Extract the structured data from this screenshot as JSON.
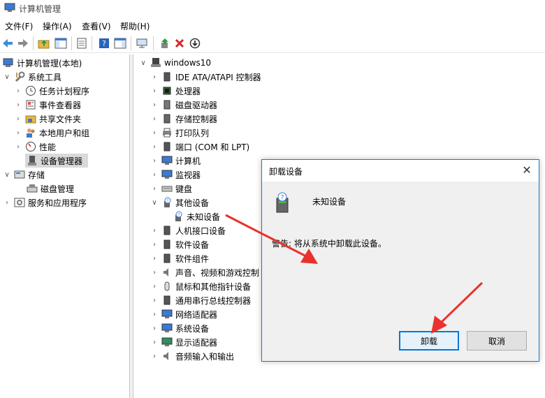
{
  "window": {
    "title": "计算机管理"
  },
  "menu": [
    "文件(F)",
    "操作(A)",
    "查看(V)",
    "帮助(H)"
  ],
  "toolbar": {
    "buttons": [
      "back-icon",
      "forward-icon",
      "up-folder-icon",
      "show-hide-tree-icon",
      "properties-icon",
      "help-icon",
      "action-pane-icon",
      "monitor-icon",
      "update-driver-icon",
      "uninstall-icon",
      "disable-icon"
    ]
  },
  "left_tree": [
    {
      "label": "计算机管理(本地)",
      "icon": "computer-management-icon"
    },
    {
      "label": "系统工具",
      "icon": "tools-icon"
    },
    {
      "label": "任务计划程序",
      "icon": "clock-icon"
    },
    {
      "label": "事件查看器",
      "icon": "event-viewer-icon"
    },
    {
      "label": "共享文件夹",
      "icon": "shared-folder-icon"
    },
    {
      "label": "本地用户和组",
      "icon": "users-icon"
    },
    {
      "label": "性能",
      "icon": "performance-icon"
    },
    {
      "label": "设备管理器",
      "icon": "device-manager-icon"
    },
    {
      "label": "存储",
      "icon": "storage-icon"
    },
    {
      "label": "磁盘管理",
      "icon": "disk-management-icon"
    },
    {
      "label": "服务和应用程序",
      "icon": "services-icon"
    }
  ],
  "device_tree": {
    "root": "windows10",
    "categories": [
      {
        "label": "IDE ATA/ATAPI 控制器",
        "icon": "ide-controller-icon"
      },
      {
        "label": "处理器",
        "icon": "processor-icon"
      },
      {
        "label": "磁盘驱动器",
        "icon": "disk-drive-icon"
      },
      {
        "label": "存储控制器",
        "icon": "storage-controller-icon"
      },
      {
        "label": "打印队列",
        "icon": "printer-icon"
      },
      {
        "label": "端口 (COM 和 LPT)",
        "icon": "port-icon"
      },
      {
        "label": "计算机",
        "icon": "computer-icon"
      },
      {
        "label": "监视器",
        "icon": "monitor-icon"
      },
      {
        "label": "键盘",
        "icon": "keyboard-icon"
      },
      {
        "label": "其他设备",
        "icon": "unknown-device-icon"
      },
      {
        "label": "未知设备",
        "icon": "unknown-device-icon"
      },
      {
        "label": "人机接口设备",
        "icon": "hid-icon"
      },
      {
        "label": "软件设备",
        "icon": "software-device-icon"
      },
      {
        "label": "软件组件",
        "icon": "software-component-icon"
      },
      {
        "label": "声音、视频和游戏控制",
        "icon": "audio-icon"
      },
      {
        "label": "鼠标和其他指针设备",
        "icon": "mouse-icon"
      },
      {
        "label": "通用串行总线控制器",
        "icon": "usb-icon"
      },
      {
        "label": "网络适配器",
        "icon": "network-adapter-icon"
      },
      {
        "label": "系统设备",
        "icon": "system-device-icon"
      },
      {
        "label": "显示适配器",
        "icon": "display-adapter-icon"
      },
      {
        "label": "音频输入和输出",
        "icon": "audio-io-icon"
      }
    ]
  },
  "dialog": {
    "title": "卸载设备",
    "device_name": "未知设备",
    "warning": "警告: 将从系统中卸载此设备。",
    "uninstall_label": "卸载",
    "cancel_label": "取消"
  },
  "colors": {
    "accent": "#0078d7",
    "annotation_arrow": "#e8322d",
    "selected": "#d9d9d9"
  }
}
